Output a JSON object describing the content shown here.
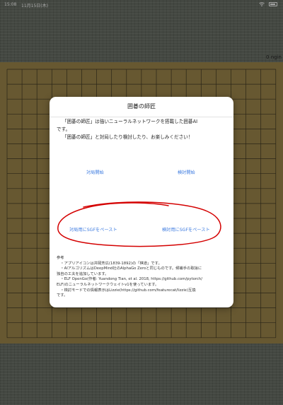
{
  "status_bar": {
    "time": "15:08",
    "date": "11月15日(木)"
  },
  "corner_label": "0  ngin",
  "board_colors": {
    "wood": "#8f7a44",
    "line": "#3a3320",
    "tatami": "#5f655c"
  },
  "dialog": {
    "title": "囲碁の師匠",
    "intro": [
      "「囲碁の師匠」は強いニューラルネットワークを搭載した囲碁AI",
      "です。",
      "「囲碁の師匠」と対局したり検討したり、お楽しみください！"
    ],
    "buttons": {
      "play": "対局開始",
      "review": "検討開始",
      "paste_play": "対局用にSGFをペースト",
      "paste_review": "検討用にSGFをペースト"
    },
    "annotation_color": "#d40000",
    "notes": [
      "参考",
      "　・アプリアイコンは井岡芳広(1839-1892)の「棋道」です。",
      "　・AIアルゴリズムはDeepMind社のAlphaGo Zeroと同じものです。候補手の取捨に",
      "独自の工夫を追加しています。",
      "　・ELF OpenGo(作者: Yuandong Tian, et al. 2018, https://github.com/pytorch/",
      "ELF)のニューラルネットワークウェイトv1を使っています。",
      "　・検討モードでの情報表示はLizzie(https://github.com/featurecat/lizzie)互換",
      "です。"
    ]
  }
}
